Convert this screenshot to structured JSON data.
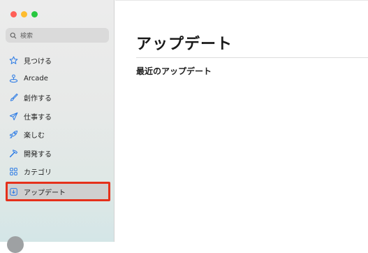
{
  "sidebar": {
    "search": {
      "placeholder": "検索",
      "icon": "search-icon"
    },
    "items": [
      {
        "label": "見つける",
        "icon": "star-icon"
      },
      {
        "label": "Arcade",
        "icon": "joystick-icon"
      },
      {
        "label": "創作する",
        "icon": "paintbrush-icon"
      },
      {
        "label": "仕事する",
        "icon": "paper-plane-icon"
      },
      {
        "label": "楽しむ",
        "icon": "rocket-icon"
      },
      {
        "label": "開発する",
        "icon": "hammer-icon"
      },
      {
        "label": "カテゴリ",
        "icon": "grid-icon"
      },
      {
        "label": "アップデート",
        "icon": "download-box-icon",
        "selected": true
      }
    ]
  },
  "main": {
    "title": "アップデート",
    "section_title": "最近のアップデート"
  },
  "colors": {
    "accent_icon": "#2c7be5",
    "selection_highlight": "#e5301b",
    "traffic_red": "#ff5f57",
    "traffic_yellow": "#febc2e",
    "traffic_green": "#28c840"
  }
}
